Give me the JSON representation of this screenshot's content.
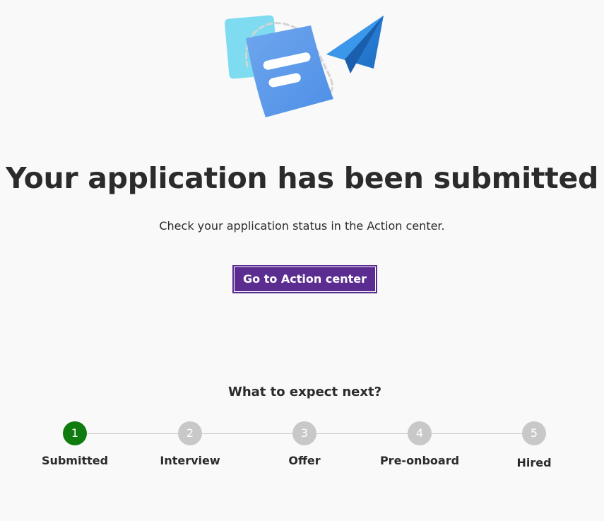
{
  "confirmation": {
    "title": "Your application has been submitted",
    "subtitle": "Check your application status in the Action center.",
    "action_button_label": "Go to Action center"
  },
  "next_steps": {
    "heading": "What to expect next?",
    "steps": [
      {
        "number": "1",
        "label": "Submitted",
        "status": "complete"
      },
      {
        "number": "2",
        "label": "Interview",
        "status": "pending"
      },
      {
        "number": "3",
        "label": "Offer",
        "status": "pending"
      },
      {
        "number": "4",
        "label": "Pre-onboard",
        "status": "pending"
      },
      {
        "number": "5",
        "label": "Hired",
        "status": "pending"
      }
    ]
  },
  "colors": {
    "accent_purple": "#5c2d91",
    "step_complete": "#107c10",
    "step_pending": "#c8c8c8",
    "background": "#f9f9f9"
  },
  "icons": {
    "illustration": "document-paper-plane-illustration"
  }
}
